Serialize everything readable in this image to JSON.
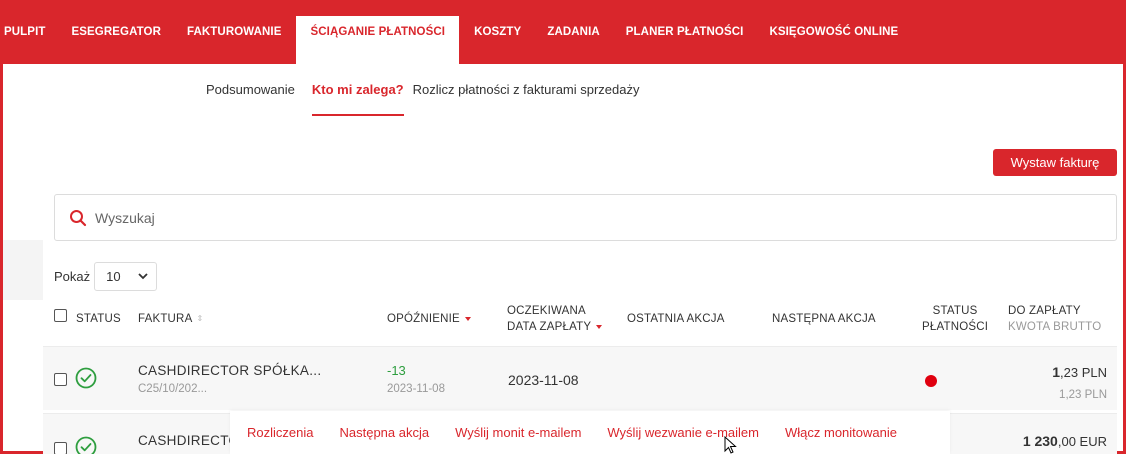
{
  "nav": {
    "items": [
      {
        "label": "PULPIT"
      },
      {
        "label": "ESEGREGATOR"
      },
      {
        "label": "FAKTUROWANIE"
      },
      {
        "label": "ŚCIĄGANIE PŁATNOŚCI"
      },
      {
        "label": "KOSZTY"
      },
      {
        "label": "ZADANIA"
      },
      {
        "label": "PLANER PŁATNOŚCI"
      },
      {
        "label": "KSIĘGOWOŚĆ ONLINE"
      }
    ],
    "active_index": 3
  },
  "subtabs": [
    {
      "label": "Podsumowanie"
    },
    {
      "label": "Kto mi zalega?"
    },
    {
      "label": "Rozlicz płatności z fakturami sprzedaży"
    }
  ],
  "toolbar": {
    "invoice_button": "Wystaw fakturę"
  },
  "search": {
    "placeholder": "Wyszukaj"
  },
  "page_size": {
    "label": "Pokaż",
    "value": "10"
  },
  "table": {
    "headers": {
      "status": "STATUS",
      "invoice": "FAKTURA",
      "delay": "OPÓŹNIENIE",
      "expected_date_1": "OCZEKIWANA",
      "expected_date_2": "DATA ZAPŁATY",
      "last_action": "OSTATNIA AKCJA",
      "next_action": "NASTĘPNA AKCJA",
      "payment_status_1": "STATUS",
      "payment_status_2": "PŁATNOŚCI",
      "to_pay_1": "DO ZAPŁATY",
      "to_pay_2": "KWOTA BRUTTO"
    },
    "rows": [
      {
        "name": "CASHDIRECTOR SPÓŁKA...",
        "invoice_no": "C25/10/202...",
        "delay": "-13",
        "delay_date": "2023-11-08",
        "expected_date": "2023-11-08",
        "amount_main": "1",
        "amount_decimals": ",23 PLN",
        "amount_gross": "1,23 PLN"
      },
      {
        "name": "CASHDIRECTOR",
        "amount_main": "1 230",
        "amount_decimals": ",00 EUR"
      }
    ]
  },
  "action_bar": {
    "items": [
      {
        "label": "Rozliczenia"
      },
      {
        "label": "Następna akcja"
      },
      {
        "label": "Wyślij monit e-mailem"
      },
      {
        "label": "Wyślij wezwanie e-mailem"
      },
      {
        "label": "Włącz monitowanie"
      }
    ]
  },
  "colors": {
    "accent": "#d9262c",
    "ok": "#2e9e3f",
    "status_dot": "#e0000f"
  }
}
